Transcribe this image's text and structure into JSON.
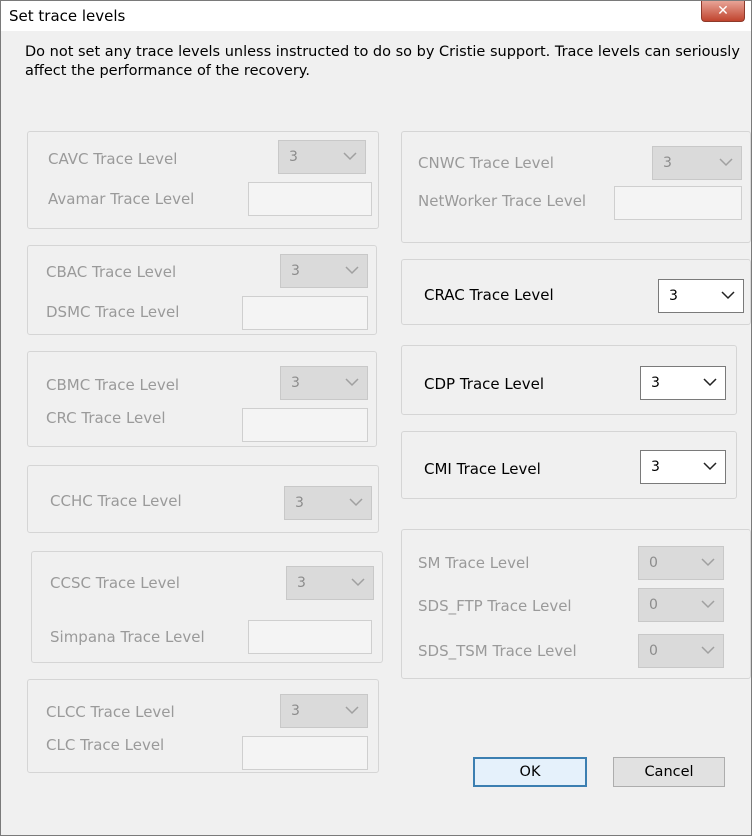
{
  "window": {
    "title": "Set trace levels",
    "close_label": "✕"
  },
  "instructions": "Do not set any trace levels unless instructed to do so by Cristie support. Trace levels can seriously affect the performance of the recovery.",
  "left_groups": {
    "cavc": {
      "label": "CAVC Trace Level",
      "value": "3"
    },
    "avamar": {
      "label": "Avamar Trace Level",
      "value": ""
    },
    "cbac": {
      "label": "CBAC Trace Level",
      "value": "3"
    },
    "dsmc": {
      "label": "DSMC Trace Level",
      "value": ""
    },
    "cbmc": {
      "label": "CBMC Trace Level",
      "value": "3"
    },
    "crc": {
      "label": "CRC Trace Level",
      "value": ""
    },
    "cchc": {
      "label": "CCHC Trace Level",
      "value": "3"
    },
    "ccsc": {
      "label": "CCSC Trace Level",
      "value": "3"
    },
    "simpana": {
      "label": "Simpana Trace Level",
      "value": ""
    },
    "clcc": {
      "label": "CLCC Trace Level",
      "value": "3"
    },
    "clc": {
      "label": "CLC Trace Level",
      "value": ""
    }
  },
  "right_groups": {
    "cnwc": {
      "label": "CNWC Trace Level",
      "value": "3"
    },
    "networker": {
      "label": "NetWorker Trace Level",
      "value": ""
    },
    "crac": {
      "label": "CRAC Trace Level",
      "value": "3"
    },
    "cdp": {
      "label": "CDP Trace Level",
      "value": "3"
    },
    "cmi": {
      "label": "CMI Trace Level",
      "value": "3"
    },
    "sm": {
      "label": "SM Trace Level",
      "value": "0"
    },
    "sds_ftp": {
      "label": "SDS_FTP Trace Level",
      "value": "0"
    },
    "sds_tsm": {
      "label": "SDS_TSM Trace Level",
      "value": "0"
    }
  },
  "buttons": {
    "ok": "OK",
    "cancel": "Cancel"
  },
  "icons": {
    "dropdown": "chevron-down-icon",
    "close": "close-icon"
  }
}
